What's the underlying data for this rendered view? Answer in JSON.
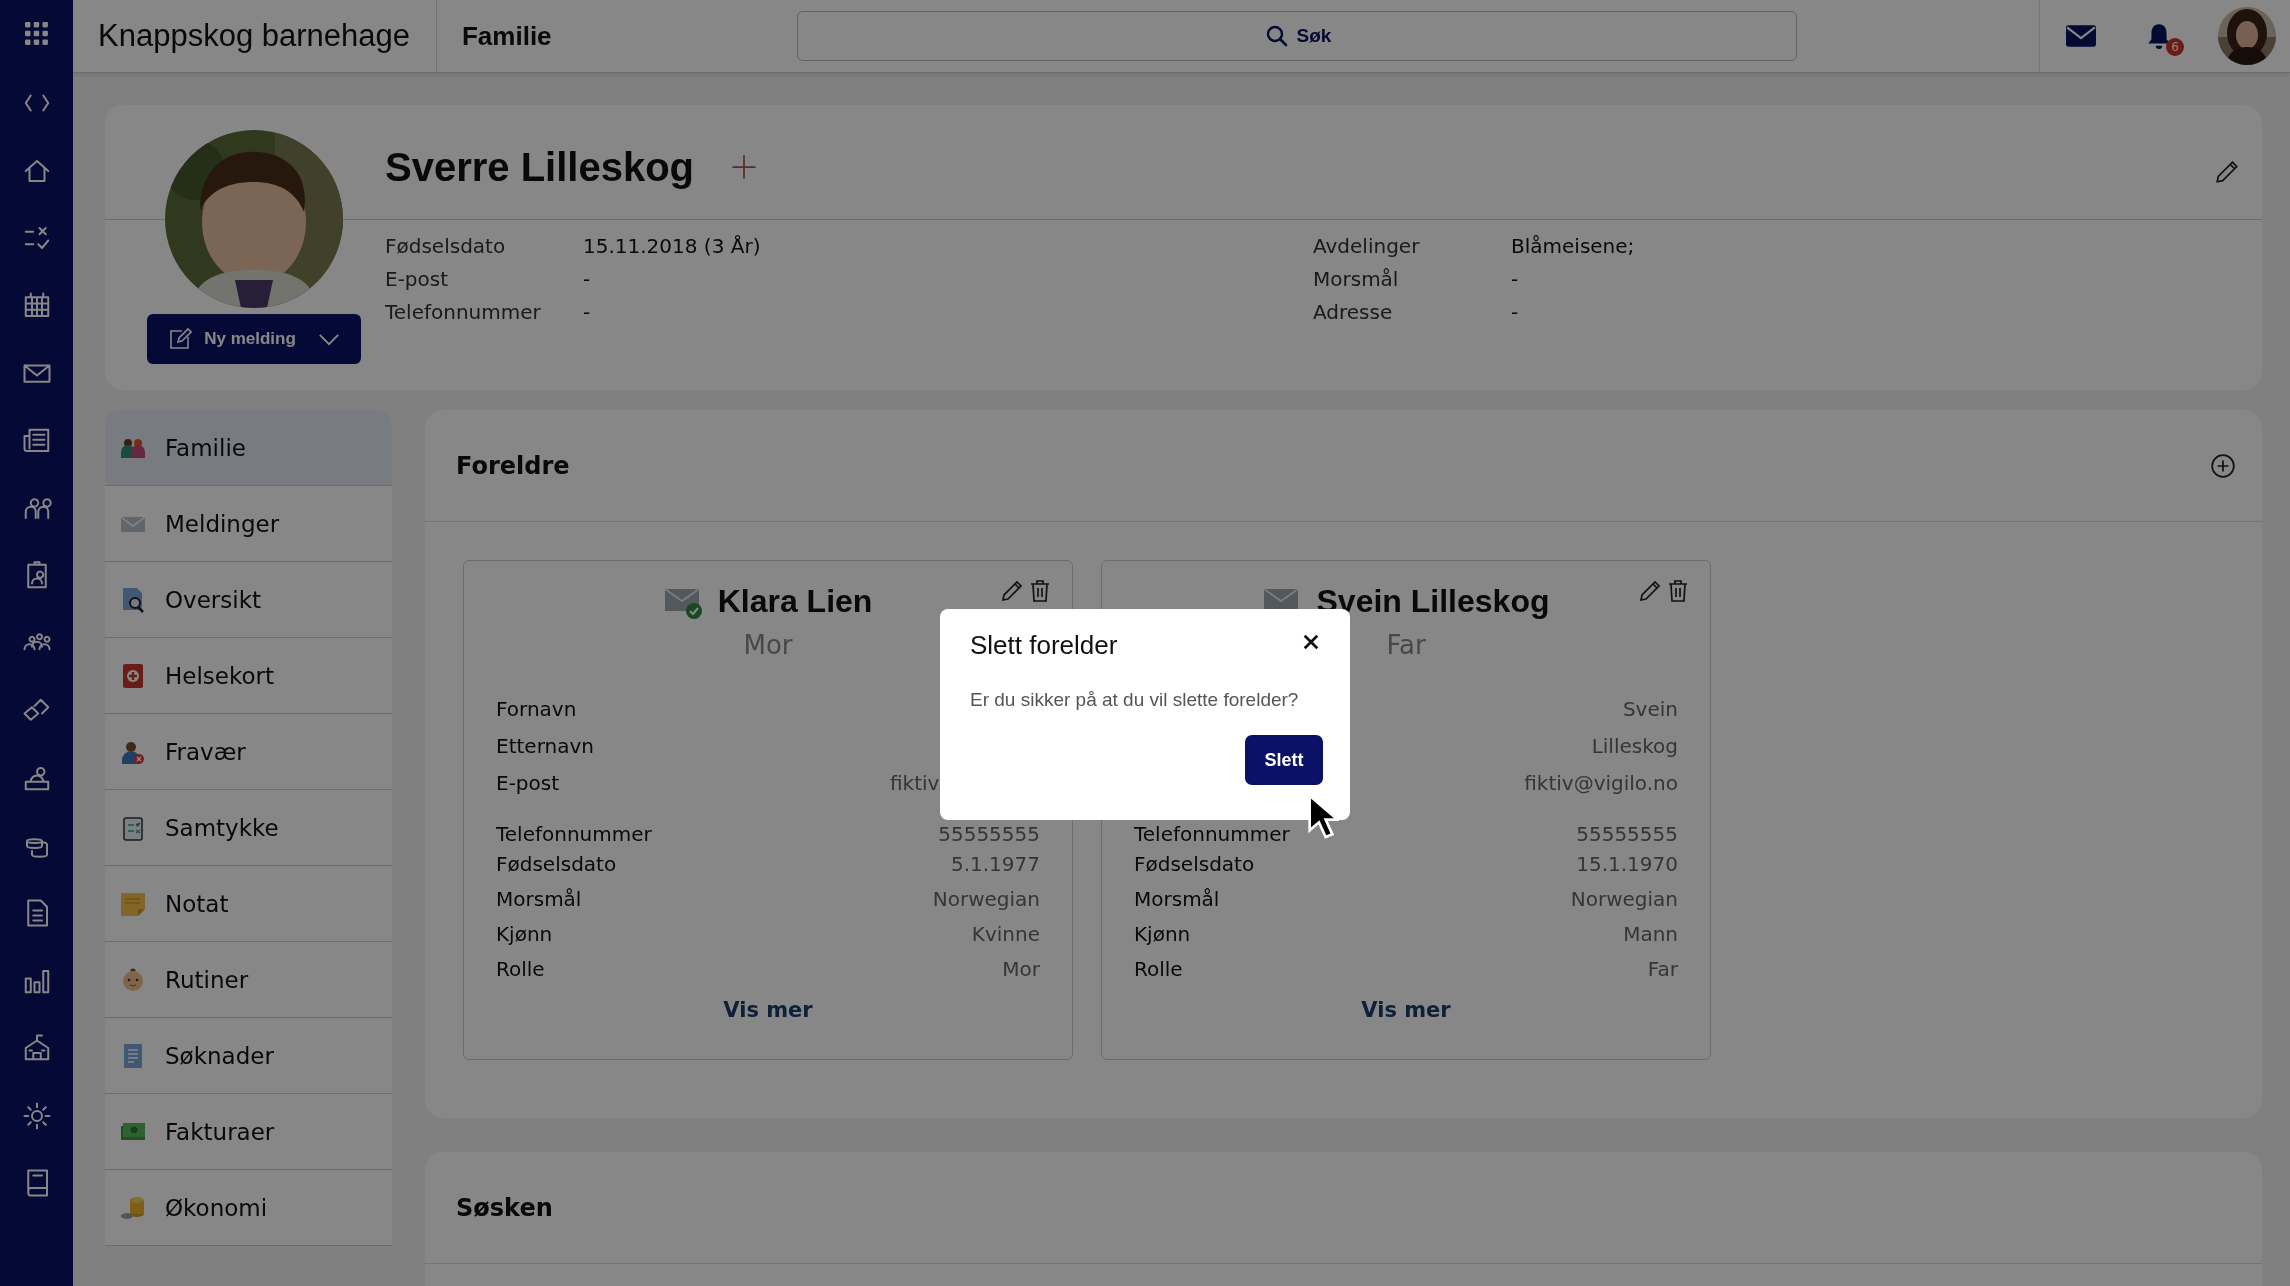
{
  "app": {
    "title": "Knappskog barnehage",
    "section": "Familie",
    "search": {
      "placeholder": "Søk"
    },
    "notifications": {
      "badge": "6"
    }
  },
  "profile": {
    "name": "Sverre Lilleskog",
    "new_message_button": "Ny melding",
    "fields_left": [
      {
        "label": "Fødselsdato",
        "value": "15.11.2018 (3 År)"
      },
      {
        "label": "E-post",
        "value": "-"
      },
      {
        "label": "Telefonnummer",
        "value": "-"
      }
    ],
    "fields_right": [
      {
        "label": "Avdelinger",
        "value": "Blåmeisene;"
      },
      {
        "label": "Morsmål",
        "value": "-"
      },
      {
        "label": "Adresse",
        "value": "-"
      }
    ]
  },
  "menu": [
    {
      "label": "Familie",
      "selected": true
    },
    {
      "label": "Meldinger",
      "selected": false
    },
    {
      "label": "Oversikt",
      "selected": false
    },
    {
      "label": "Helsekort",
      "selected": false
    },
    {
      "label": "Fravær",
      "selected": false
    },
    {
      "label": "Samtykke",
      "selected": false
    },
    {
      "label": "Notat",
      "selected": false
    },
    {
      "label": "Rutiner",
      "selected": false
    },
    {
      "label": "Søknader",
      "selected": false
    },
    {
      "label": "Fakturaer",
      "selected": false
    },
    {
      "label": "Økonomi",
      "selected": false
    }
  ],
  "parents_panel": {
    "title": "Foreldre",
    "parents": [
      {
        "name": "Klara Lien",
        "role": "Mor",
        "verified": true,
        "more": "Vis mer",
        "rows": [
          {
            "label": "Fornavn"
          },
          {
            "label": "Etternavn"
          },
          {
            "label": "E-post",
            "value": "fiktiv",
            "cut": true
          },
          {
            "label": "Telefonnummer",
            "value": "55555555"
          },
          {
            "label": "Fødselsdato",
            "value": "5.1.1977"
          },
          {
            "label": "Morsmål",
            "value": "Norwegian"
          },
          {
            "label": "Kjønn",
            "value": "Kvinne"
          },
          {
            "label": "Rolle",
            "value": "Mor"
          }
        ]
      },
      {
        "name": "Svein Lilleskog",
        "role": "Far",
        "verified": false,
        "more": "Vis mer",
        "rows": [
          {
            "value": "Svein"
          },
          {
            "value": "Lilleskog"
          },
          {
            "value": "fiktiv@vigilo.no"
          },
          {
            "label": "Telefonnummer",
            "value": "55555555"
          },
          {
            "label": "Fødselsdato",
            "value": "15.1.1970"
          },
          {
            "label": "Morsmål",
            "value": "Norwegian"
          },
          {
            "label": "Kjønn",
            "value": "Mann"
          },
          {
            "label": "Rolle",
            "value": "Far"
          }
        ]
      }
    ]
  },
  "siblings_panel": {
    "title": "Søsken"
  },
  "dialog": {
    "title": "Slett forelder",
    "message": "Er du sikker på at du vil slette forelder?",
    "confirm": "Slett"
  }
}
